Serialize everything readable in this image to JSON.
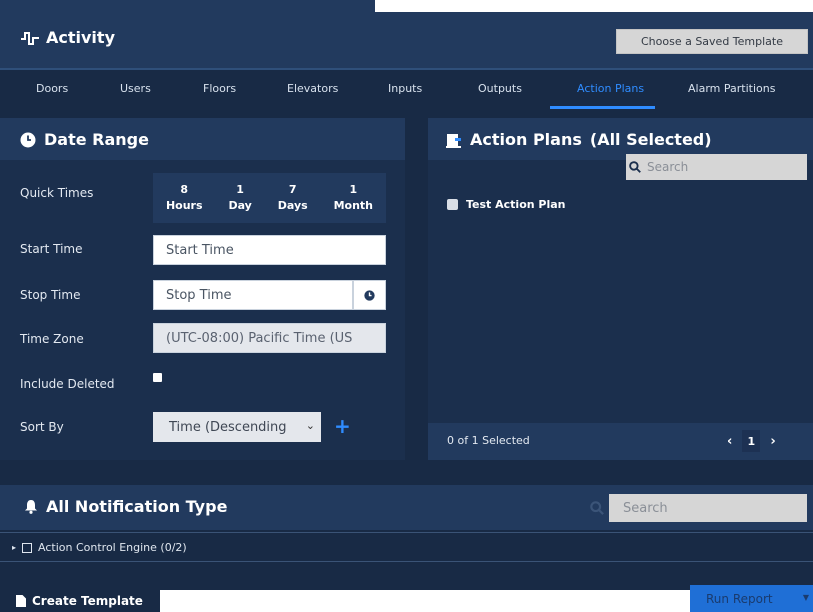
{
  "header": {
    "title": "Activity",
    "template_button": "Choose a Saved Template"
  },
  "tabs": [
    {
      "label": "Doors"
    },
    {
      "label": "Users"
    },
    {
      "label": "Floors"
    },
    {
      "label": "Elevators"
    },
    {
      "label": "Inputs"
    },
    {
      "label": "Outputs"
    },
    {
      "label": "Action Plans",
      "active": true
    },
    {
      "label": "Alarm Partitions"
    }
  ],
  "date_range": {
    "title": "Date Range",
    "quick_times_label": "Quick Times",
    "quick_times": [
      {
        "value": "8",
        "unit": "Hours"
      },
      {
        "value": "1",
        "unit": "Day"
      },
      {
        "value": "7",
        "unit": "Days"
      },
      {
        "value": "1",
        "unit": "Month"
      }
    ],
    "start_label": "Start Time",
    "start_placeholder": "Start Time",
    "stop_label": "Stop Time",
    "stop_placeholder": "Stop Time",
    "tz_label": "Time Zone",
    "tz_value": "(UTC-08:00) Pacific Time (US",
    "deleted_label": "Include Deleted",
    "sort_label": "Sort By",
    "sort_value": "Time (Descending"
  },
  "action_plans": {
    "title": "Action Plans",
    "subtitle": "(All Selected)",
    "search_placeholder": "Search",
    "items": [
      {
        "label": "Test Action Plan"
      }
    ],
    "selected_status": "0 of 1 Selected",
    "page": "1"
  },
  "notifications": {
    "title": "All Notification Type",
    "search_placeholder": "Search",
    "rows": [
      {
        "label": "Action Control Engine (0/2)"
      }
    ]
  },
  "footer": {
    "create_label": "Create Template",
    "run_label": "Run Report"
  },
  "colors": {
    "background": "#182a45",
    "panel": "#1b2f4d",
    "header": "#223a5e",
    "accent": "#2f8cff"
  }
}
